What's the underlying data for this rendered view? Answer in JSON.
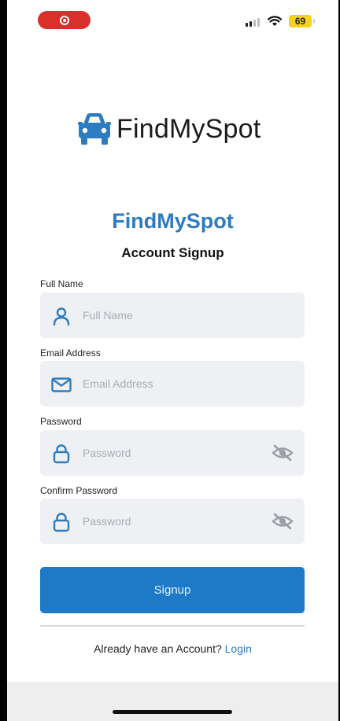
{
  "status_bar": {
    "battery_level": "69",
    "colors": {
      "recording": "#d9302b",
      "battery": "#f4d21f"
    }
  },
  "logo": {
    "text": "FindMySpot",
    "icon": "car-icon",
    "icon_color": "#2d7bc0"
  },
  "header": {
    "title": "FindMySpot",
    "subtitle": "Account Signup"
  },
  "form": {
    "full_name": {
      "label": "Full Name",
      "placeholder": "Full Name",
      "icon": "person-icon"
    },
    "email": {
      "label": "Email Address",
      "placeholder": "Email Address",
      "icon": "envelope-icon"
    },
    "password": {
      "label": "Password",
      "placeholder": "Password",
      "icon": "lock-icon",
      "toggle_icon": "eye-off-icon"
    },
    "confirm_password": {
      "label": "Confirm Password",
      "placeholder": "Password",
      "icon": "lock-icon",
      "toggle_icon": "eye-off-icon"
    }
  },
  "actions": {
    "signup_label": "Signup",
    "login_prompt": "Already have an Account?",
    "login_link": "Login",
    "accent_color": "#1e79c7"
  }
}
